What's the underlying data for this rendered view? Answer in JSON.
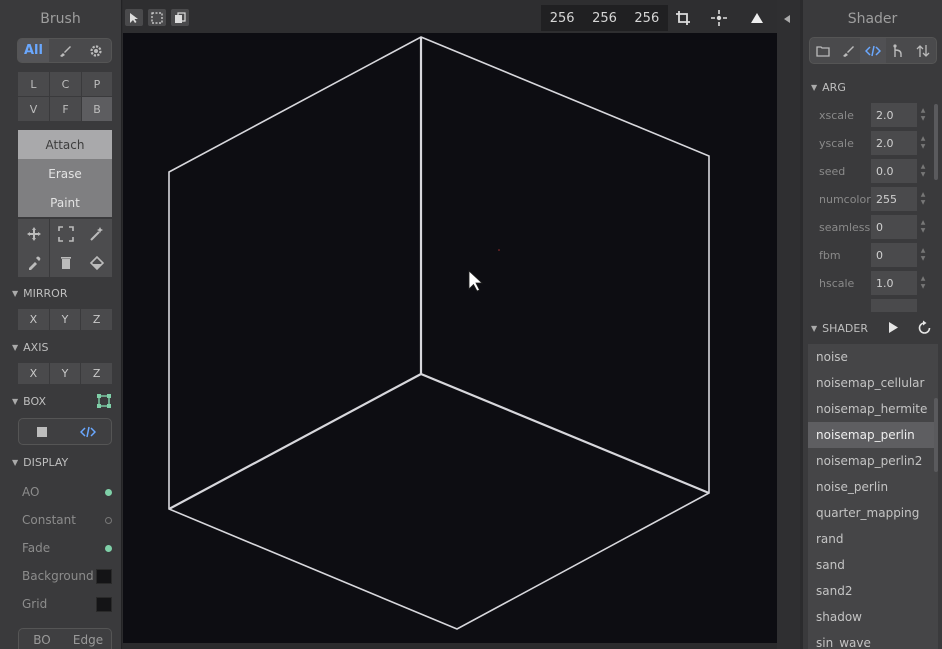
{
  "left_panel": {
    "title": "Brush",
    "filter_tabs": {
      "all": "All"
    },
    "type_grid": [
      "L",
      "C",
      "P",
      "V",
      "F",
      "B"
    ],
    "modes": [
      "Attach",
      "Erase",
      "Paint"
    ],
    "sections": {
      "mirror": "MIRROR",
      "axis": "AXIS",
      "box": "BOX",
      "display": "DISPLAY"
    },
    "mirror_axes": [
      "X",
      "Y",
      "Z"
    ],
    "axis_axes": [
      "X",
      "Y",
      "Z"
    ],
    "display_items": [
      {
        "label": "AO"
      },
      {
        "label": "Constant"
      },
      {
        "label": "Fade"
      },
      {
        "label": "Background"
      },
      {
        "label": "Grid"
      }
    ],
    "bottom_tabs": [
      "BO",
      "Edge"
    ]
  },
  "top_bar": {
    "dims": [
      "256",
      "256",
      "256"
    ]
  },
  "right_panel": {
    "title": "Shader",
    "arg_section": "ARG",
    "args": [
      {
        "name": "xscale",
        "value": "2.0"
      },
      {
        "name": "yscale",
        "value": "2.0"
      },
      {
        "name": "seed",
        "value": "0.0"
      },
      {
        "name": "numcolor",
        "value": "255"
      },
      {
        "name": "seamless",
        "value": "0"
      },
      {
        "name": "fbm",
        "value": "0"
      },
      {
        "name": "hscale",
        "value": "1.0"
      }
    ],
    "shader_section": "SHADER",
    "shaders": [
      "noise",
      "noisemap_cellular",
      "noisemap_hermite",
      "noisemap_perlin",
      "noisemap_perlin2",
      "noise_perlin",
      "quarter_mapping",
      "rand",
      "sand",
      "sand2",
      "shadow",
      "sin_wave"
    ]
  },
  "colors": {
    "accent": "#7fd0a8",
    "link_blue": "#6aa8ff",
    "viewport_bg": "#0d0d12",
    "cube_line": "#d7d7dc"
  }
}
